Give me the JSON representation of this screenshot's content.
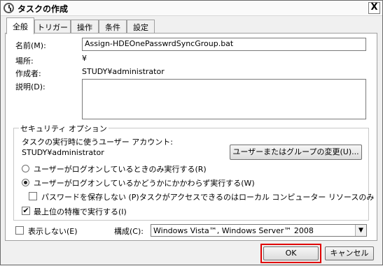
{
  "window": {
    "title": "タスクの作成",
    "close_label": "X"
  },
  "tabs": [
    {
      "label": "全般",
      "active": true
    },
    {
      "label": "トリガー",
      "active": false
    },
    {
      "label": "操作",
      "active": false
    },
    {
      "label": "条件",
      "active": false
    },
    {
      "label": "設定",
      "active": false
    }
  ],
  "general": {
    "name_label": "名前(M):",
    "name_value": "Assign-HDEOnePasswrdSyncGroup.bat",
    "location_label": "場所:",
    "location_value": "¥",
    "author_label": "作成者:",
    "author_value": "STUDY¥administrator",
    "description_label": "説明(D):",
    "description_value": ""
  },
  "security": {
    "group_label": "セキュリティ オプション",
    "account_prompt": "タスクの実行時に使うユーザー アカウント:",
    "account_value": "STUDY¥administrator",
    "change_user_button": "ユーザーまたはグループの変更(U)...",
    "radio_logged_on_only": "ユーザーがログオンしているときのみ実行する(R)",
    "radio_whether_logged_on": "ユーザーがログオンしているかどうかにかかわらず実行する(W)",
    "radio_selected": "whether_logged_on",
    "no_store_password_label": "パスワードを保存しない (P)タスクがアクセスできるのはローカル コンピューター リソースのみ",
    "no_store_password_checked": false,
    "highest_privileges_label": "最上位の特権で実行する(I)",
    "highest_privileges_checked": true
  },
  "footer": {
    "hidden_label": "表示しない(E)",
    "hidden_checked": false,
    "configure_label": "構成(C):",
    "configure_value": "Windows Vista™, Windows Server™ 2008"
  },
  "buttons": {
    "ok": "OK",
    "cancel": "キャンセル"
  },
  "colors": {
    "highlight": "#e00000",
    "panel": "#ffffff",
    "chrome": "#f0f0f0"
  }
}
